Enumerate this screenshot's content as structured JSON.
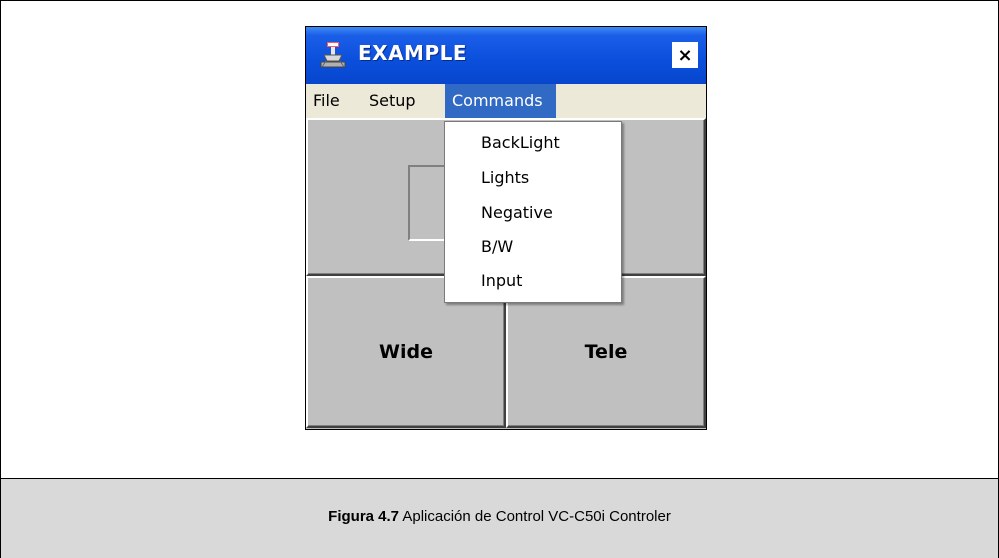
{
  "window": {
    "title": "EXAMPLE",
    "close_symbol": "×",
    "icon": "app-icon"
  },
  "menubar": {
    "items": [
      {
        "label": "File"
      },
      {
        "label": "Setup"
      },
      {
        "label": "Commands"
      }
    ]
  },
  "dropdown": {
    "items": [
      {
        "label": "BackLight"
      },
      {
        "label": "Lights"
      },
      {
        "label": "Negative"
      },
      {
        "label": "B/W"
      },
      {
        "label": "Input"
      }
    ]
  },
  "buttons": {
    "wide_label": "Wide",
    "tele_label": "Tele"
  },
  "caption": {
    "figure_label": "Figura 4.7",
    "text": " Aplicación de Control VC-C50i Controler"
  },
  "colors": {
    "titlebar": "#0a4fdc",
    "menu_highlight": "#316ac5",
    "button_face": "#c0c0c0",
    "caption_band": "#d9d9d9"
  }
}
